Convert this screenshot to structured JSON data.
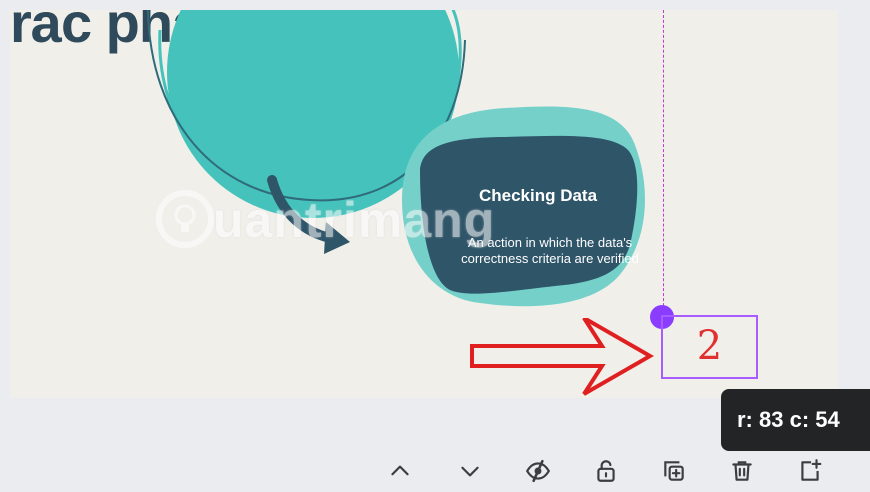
{
  "page": {
    "title_fragment": "rác phẩm"
  },
  "card": {
    "title": "Checking Data",
    "body": "An action in which the data's correctness criteria are verified"
  },
  "watermark": {
    "text": "uantrimang"
  },
  "annotation": {
    "number": "2",
    "number_color": "#e03030",
    "box_color": "#a85cff",
    "arrow_color": "#e02020"
  },
  "guide": {
    "color": "#c33ad6",
    "dot_color": "#8b3dff"
  },
  "tooltip": {
    "text": "r: 83 c: 54"
  },
  "toolbar": {
    "buttons": [
      {
        "name": "move-up",
        "icon": "chevron-up-icon"
      },
      {
        "name": "move-down",
        "icon": "chevron-down-icon"
      },
      {
        "name": "hide",
        "icon": "eye-slash-icon"
      },
      {
        "name": "lock",
        "icon": "unlock-icon"
      },
      {
        "name": "duplicate",
        "icon": "duplicate-icon"
      },
      {
        "name": "delete",
        "icon": "trash-icon"
      },
      {
        "name": "add-page",
        "icon": "add-page-icon"
      }
    ]
  },
  "colors": {
    "teal": "#45c2bb",
    "teal_light": "#74d0c9",
    "navy": "#2f5569",
    "title": "#2f4a5a",
    "page_bg": "#f0efea",
    "workspace_bg": "#ebecf0"
  }
}
